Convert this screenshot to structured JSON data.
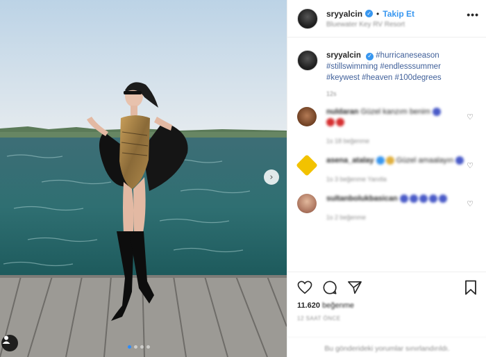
{
  "header": {
    "username": "sryyalcin",
    "separator": "•",
    "follow_label": "Takip Et",
    "location": "Bluewater Key RV Resort",
    "more_icon": "ellipsis-icon"
  },
  "caption": {
    "username": "sryyalcin",
    "hashtags": [
      "#hurricaneseason",
      "#stillswimming",
      "#endlesssummer",
      "#keywest",
      "#heaven",
      "#100degrees"
    ],
    "time": "12s"
  },
  "comments": [
    {
      "username": "nuldaran",
      "text": "Güzel kanzım benim",
      "meta": "1s   18 beğenme",
      "avatar_color": "#7a4a2a"
    },
    {
      "username": "asena_atalay",
      "text": "Güzel amaalayın",
      "meta": "1s   3 beğenme   Yanıtla",
      "avatar_color": "#f2c200"
    },
    {
      "username": "sultanbolukbasican",
      "text": "",
      "meta": "1s   2 beğenme",
      "avatar_color": "#c98f6e"
    }
  ],
  "actions": {
    "likes_count": "11.620",
    "likes_word": "beğenme",
    "post_date": "12 SAAT ÖNCE",
    "comments_disabled": "Bu gönderideki yorumlar sınırlandırıldı."
  },
  "photo": {
    "carousel_dots": 4,
    "active_dot": 0
  }
}
